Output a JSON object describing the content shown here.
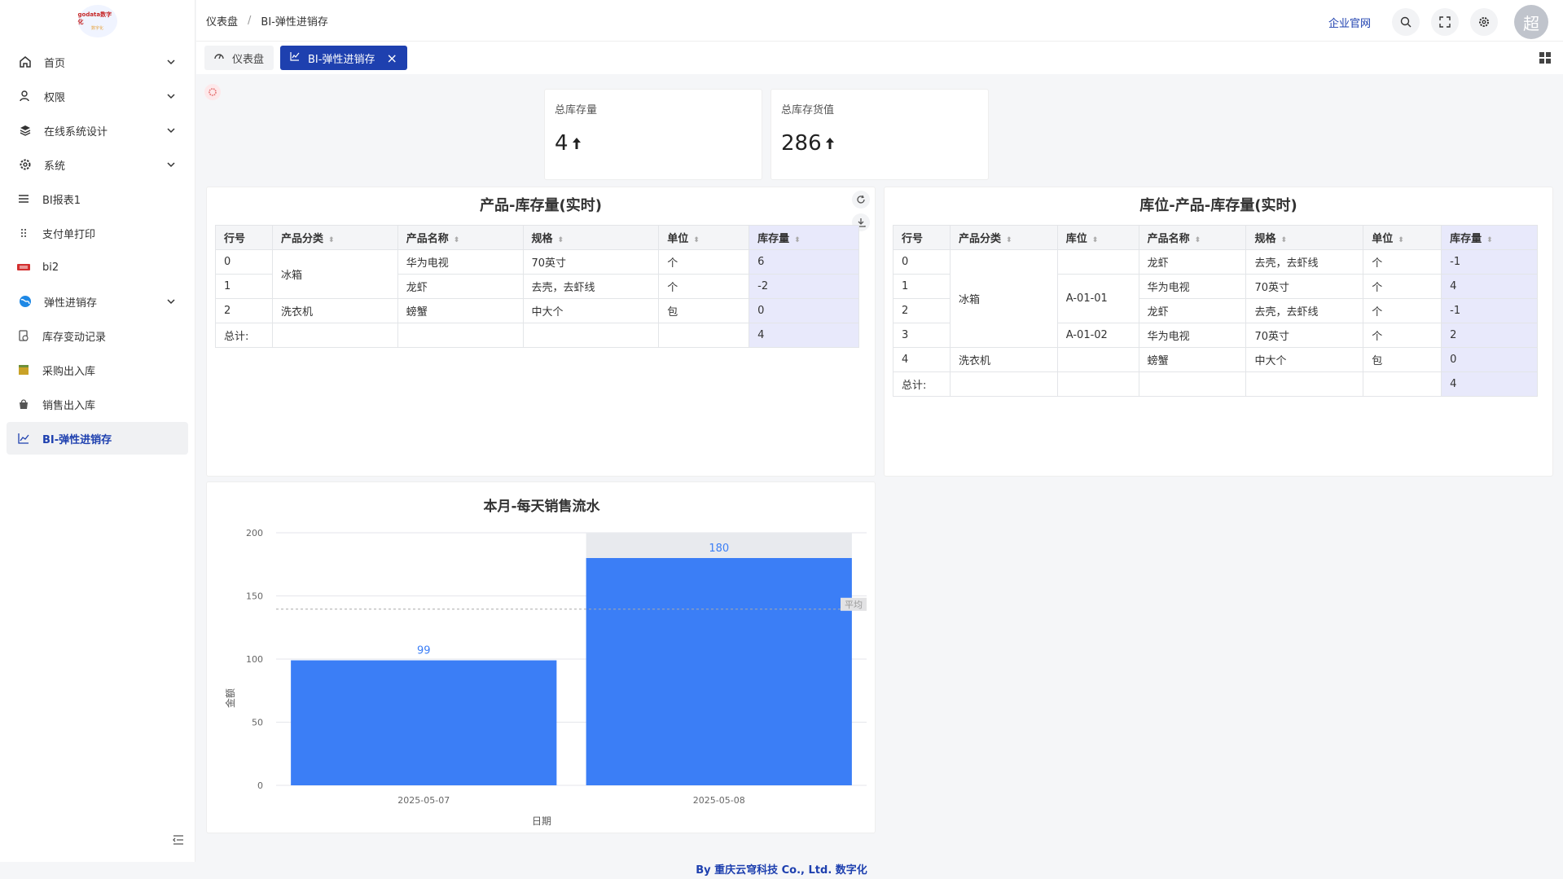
{
  "app": {
    "logo_top": "godata数字化",
    "logo_bottom": "数字化"
  },
  "sidebar": {
    "items": [
      {
        "label": "首页",
        "icon": "home-icon",
        "chevron": true
      },
      {
        "label": "权限",
        "icon": "user-lock-icon",
        "chevron": true
      },
      {
        "label": "在线系统设计",
        "icon": "layers-icon",
        "chevron": true
      },
      {
        "label": "系统",
        "icon": "gear-icon",
        "chevron": true
      },
      {
        "label": "BI报表1",
        "icon": "list-icon",
        "chevron": false
      },
      {
        "label": "支付单打印",
        "icon": "dots-grip-icon",
        "chevron": false
      },
      {
        "label": "bi2",
        "icon": "brand-icon",
        "chevron": false
      },
      {
        "label": "弹性进销存",
        "icon": "globe-icon",
        "chevron": true
      },
      {
        "label": "库存变动记录",
        "icon": "record-icon",
        "chevron": false
      },
      {
        "label": "采购出入库",
        "icon": "box-icon",
        "chevron": false
      },
      {
        "label": "销售出入库",
        "icon": "bag-icon",
        "chevron": false
      },
      {
        "label": "BI-弹性进销存",
        "icon": "chart-line-icon",
        "chevron": false
      }
    ]
  },
  "header": {
    "crumb1": "仪表盘",
    "crumb2": "BI-弹性进销存",
    "link": "企业官网",
    "avatar": "超"
  },
  "tabs": [
    {
      "label": "仪表盘"
    },
    {
      "label": "BI-弹性进销存"
    }
  ],
  "kpis": [
    {
      "label": "总库存量",
      "value": "4"
    },
    {
      "label": "总库存货值",
      "value": "286"
    }
  ],
  "table1": {
    "title": "产品-库存量(实时)",
    "headers": [
      "行号",
      "产品分类",
      "产品名称",
      "规格",
      "单位",
      "库存量"
    ],
    "rows": [
      [
        "0",
        "冰箱",
        "华为电视",
        "70英寸",
        "个",
        "6"
      ],
      [
        "1",
        "",
        "龙虾",
        "去壳，去虾线",
        "个",
        "-2"
      ],
      [
        "2",
        "洗衣机",
        "螃蟹",
        "中大个",
        "包",
        "0"
      ]
    ],
    "total_label": "总计:",
    "total_value": "4"
  },
  "table2": {
    "title": "库位-产品-库存量(实时)",
    "headers": [
      "行号",
      "产品分类",
      "库位",
      "产品名称",
      "规格",
      "单位",
      "库存量"
    ],
    "rows": [
      [
        "0",
        "冰箱",
        "",
        "龙虾",
        "去壳，去虾线",
        "个",
        "-1"
      ],
      [
        "1",
        "",
        "A-01-01",
        "华为电视",
        "70英寸",
        "个",
        "4"
      ],
      [
        "2",
        "",
        "",
        "龙虾",
        "去壳，去虾线",
        "个",
        "-1"
      ],
      [
        "3",
        "",
        "A-01-02",
        "华为电视",
        "70英寸",
        "个",
        "2"
      ],
      [
        "4",
        "洗衣机",
        "",
        "螃蟹",
        "中大个",
        "包",
        "0"
      ]
    ],
    "total_label": "总计:",
    "total_value": "4"
  },
  "chart_data": {
    "type": "bar",
    "title": "本月-每天销售流水",
    "categories": [
      "2025-05-07",
      "2025-05-08"
    ],
    "values": [
      99,
      180
    ],
    "xlabel": "日期",
    "ylabel": "金额",
    "ylim": [
      0,
      200
    ],
    "yticks": [
      0,
      50,
      100,
      150,
      200
    ],
    "average_label": "平均",
    "average_value": 139.5,
    "bar_color": "#3b7ef6",
    "grid": true
  },
  "footer": {
    "text": "By 重庆云穹科技 Co., Ltd. 数字化"
  },
  "watermark": "数字化",
  "colors": {
    "accent": "#1e40af",
    "bar": "#3b7ef6",
    "highlight": "#e8e9fb"
  }
}
